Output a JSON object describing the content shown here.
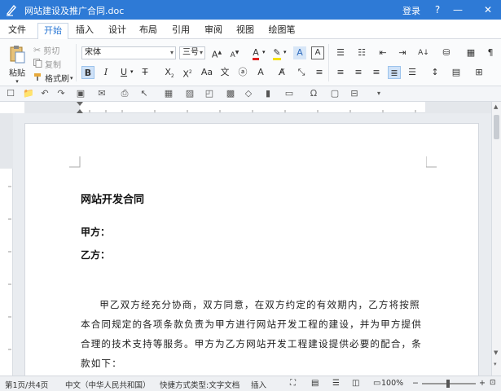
{
  "app": {
    "title": "网站建设及推广合同.doc",
    "login": "登录",
    "help": "?",
    "minimize": "—",
    "close": "✕"
  },
  "menu": {
    "file": "文件",
    "home": "开始",
    "insert": "插入",
    "design": "设计",
    "layout": "布局",
    "references": "引用",
    "review": "审阅",
    "view": "视图",
    "drawing": "绘图笔"
  },
  "ribbon": {
    "paste": "粘贴",
    "cut": "剪切",
    "copy": "复制",
    "format_painter": "格式刷",
    "font_name": "宋体",
    "font_size": "三号"
  },
  "document": {
    "title": "网站开发合同",
    "party_a": "甲方：",
    "party_b": "乙方：",
    "paragraph": "甲乙双方经充分协商，双方同意，在双方约定的有效期内，乙方将按照本合同规定的各项条款负责为甲方进行网站开发工程的建设，并为甲方提供合理的技术支持等服务。甲方为乙方网站开发工程建设提供必要的配合，条款如下："
  },
  "status": {
    "page": "第1页/共4页",
    "language": "中文（中华人民共和国）",
    "doc_type": "快捷方式类型:文字文档",
    "mode": "插入",
    "zoom": "100%"
  },
  "colors": {
    "accent": "#2e7ad6",
    "font_color": "#e02020",
    "highlight": "#f5e100"
  }
}
